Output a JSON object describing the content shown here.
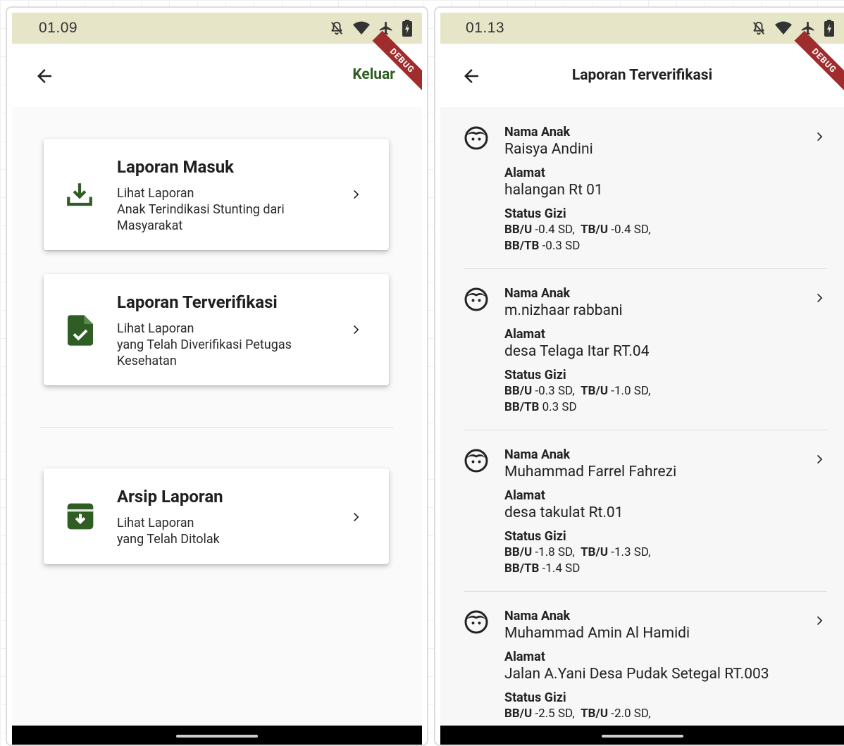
{
  "left_screen": {
    "status_time": "01.09",
    "logout_label": "Keluar",
    "debug_label": "DEBUG",
    "cards": [
      {
        "title": "Laporan Masuk",
        "subtitle": "Lihat Laporan",
        "description": "Anak Terindikasi Stunting dari\nMasyarakat",
        "icon": "download-icon"
      },
      {
        "title": "Laporan Terverifikasi",
        "subtitle": "Lihat Laporan",
        "description": "yang Telah Diverifikasi Petugas\nKesehatan",
        "icon": "file-check-icon"
      },
      {
        "title": "Arsip Laporan",
        "subtitle": "Lihat Laporan",
        "description": "yang Telah Ditolak",
        "icon": "archive-icon"
      }
    ]
  },
  "right_screen": {
    "status_time": "01.13",
    "title": "Laporan Terverifikasi",
    "debug_label": "DEBUG",
    "labels": {
      "name": "Nama Anak",
      "address": "Alamat",
      "status": "Status Gizi"
    },
    "reports": [
      {
        "name": "Raisya Andini",
        "address": "halangan Rt 01",
        "bbu": "-0.4 SD,",
        "tbu": "-0.4 SD,",
        "bbtb": "-0.3 SD"
      },
      {
        "name": "m.nizhaar rabbani",
        "address": "desa Telaga Itar RT.04",
        "bbu": "-0.3 SD,",
        "tbu": "-1.0 SD,",
        "bbtb": "0.3 SD"
      },
      {
        "name": "Muhammad Farrel Fahrezi",
        "address": "desa takulat Rt.01",
        "bbu": "-1.8 SD,",
        "tbu": "-1.3 SD,",
        "bbtb": "-1.4 SD"
      },
      {
        "name": "Muhammad Amin Al Hamidi",
        "address": "Jalan A.Yani Desa Pudak Setegal RT.003",
        "bbu": "-2.5 SD,",
        "tbu": "-2.0 SD,",
        "bbtb": ""
      }
    ],
    "gizi_keys": {
      "bbu": "BB/U",
      "tbu": "TB/U",
      "bbtb": "BB/TB"
    }
  },
  "colors": {
    "primary_green": "#2e5e24",
    "status_bar": "#e6e5c8",
    "debug_red": "#a02d2d"
  }
}
